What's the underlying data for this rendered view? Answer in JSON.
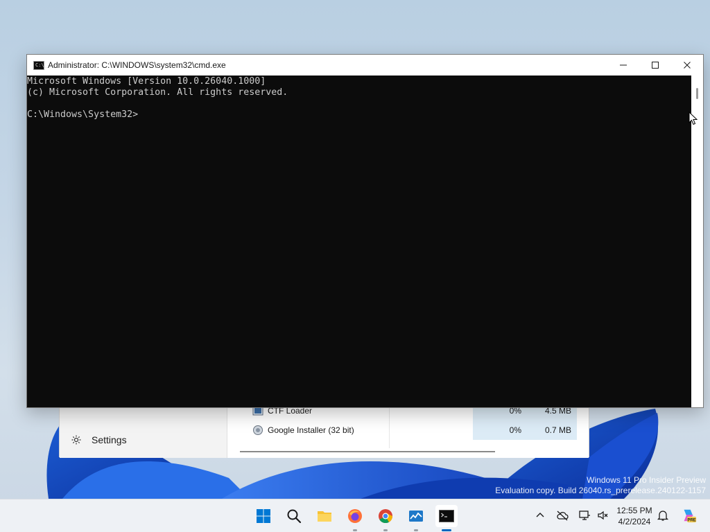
{
  "cmd": {
    "title": "Administrator: C:\\WINDOWS\\system32\\cmd.exe",
    "icon_text": "C:\\_",
    "lines": [
      "Microsoft Windows [Version 10.0.26040.1000]",
      "(c) Microsoft Corporation. All rights reserved.",
      "",
      "C:\\Windows\\System32>"
    ]
  },
  "taskmgr": {
    "nav_settings_label": "Settings",
    "rows": [
      {
        "name": "CTF Loader",
        "cpu": "0%",
        "memory": "4.5 MB"
      },
      {
        "name": "Google Installer (32 bit)",
        "cpu": "0%",
        "memory": "0.7 MB"
      }
    ]
  },
  "watermark": {
    "line1": "Windows 11 Pro Insider Preview",
    "line2": "Evaluation copy. Build 26040.rs_prerelease.240122-1157"
  },
  "taskbar": {
    "apps": [
      "start-icon",
      "search-icon",
      "file-explorer-icon",
      "firefox-icon",
      "chrome-icon",
      "task-manager-icon",
      "command-prompt-icon"
    ],
    "tray": [
      "chevron-up-icon",
      "cloud-offline-icon",
      "network-icon",
      "volume-muted-icon",
      "notification-bell-icon",
      "copilot-pre-icon"
    ],
    "time": "12:55 PM",
    "date": "4/2/2024",
    "copilot_badge": "PRE"
  },
  "colors": {
    "accent": "#0067c0",
    "console_bg": "#0c0c0c",
    "console_text": "#cccccc"
  }
}
